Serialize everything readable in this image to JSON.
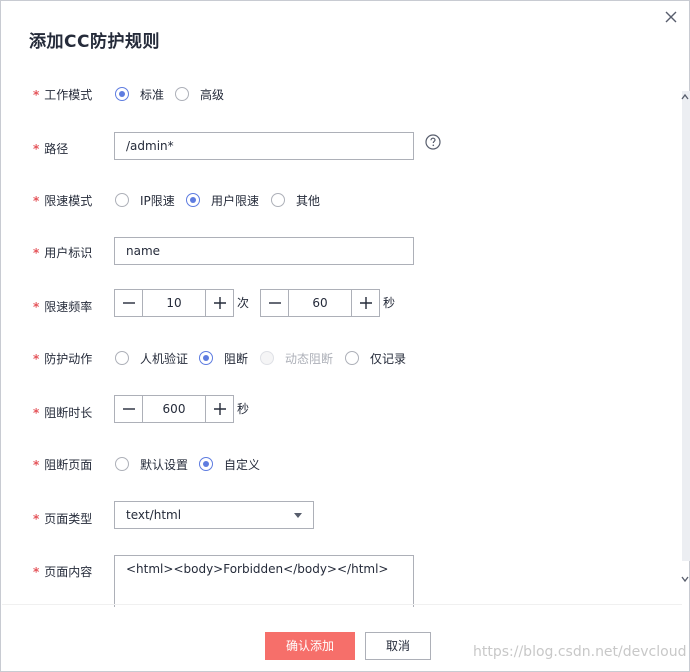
{
  "dialog": {
    "title": "添加CC防护规则",
    "close_icon": "close-icon"
  },
  "form": {
    "work_mode": {
      "label": "工作模式",
      "options": [
        "标准",
        "高级"
      ],
      "selected": "标准"
    },
    "path": {
      "label": "路径",
      "value": "/admin*",
      "help_icon": "question-circle-icon"
    },
    "limit_mode": {
      "label": "限速模式",
      "options": [
        "IP限速",
        "用户限速",
        "其他"
      ],
      "selected": "用户限速"
    },
    "user_id": {
      "label": "用户标识",
      "value": "name"
    },
    "rate": {
      "label": "限速频率",
      "count": "10",
      "count_unit": "次",
      "period": "60",
      "period_unit": "秒"
    },
    "action": {
      "label": "防护动作",
      "options": [
        "人机验证",
        "阻断",
        "动态阻断",
        "仅记录"
      ],
      "selected": "阻断",
      "disabled": [
        "动态阻断"
      ]
    },
    "block_duration": {
      "label": "阻断时长",
      "value": "600",
      "unit": "秒"
    },
    "block_page": {
      "label": "阻断页面",
      "options": [
        "默认设置",
        "自定义"
      ],
      "selected": "自定义"
    },
    "page_type": {
      "label": "页面类型",
      "value": "text/html"
    },
    "page_content": {
      "label": "页面内容",
      "value": "<html><body>Forbidden</body></html>"
    },
    "required_mark": "*"
  },
  "footer": {
    "confirm_label": "确认添加",
    "cancel_label": "取消"
  },
  "watermark": "https://blog.csdn.net/devcloud",
  "colors": {
    "accent": "#5e7ce0",
    "primary_button": "#f66f6a",
    "required": "#e5555b"
  }
}
